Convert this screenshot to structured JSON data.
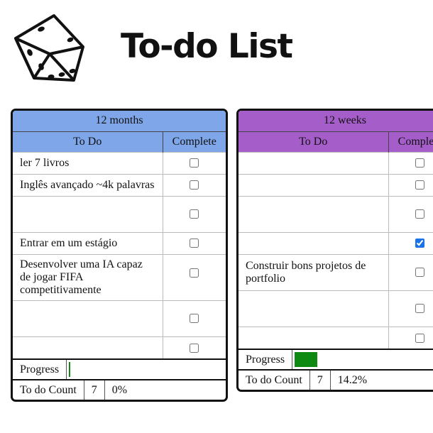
{
  "header": {
    "title": "To-do List",
    "logo_icon": "dice-icon"
  },
  "panels": [
    {
      "title": "12 months",
      "accent": "#7ea6e8",
      "columns": {
        "todo": "To Do",
        "complete": "Complete"
      },
      "rows": [
        {
          "text": "ler 7 livros",
          "checked": false
        },
        {
          "text": "Inglês avançado ~4k palavras",
          "checked": false
        },
        {
          "text": "",
          "checked": false
        },
        {
          "text": "Entrar em um estágio",
          "checked": false
        },
        {
          "text": "Desenvolver uma IA capaz de jogar FIFA competitivamente",
          "checked": false
        },
        {
          "text": "",
          "checked": false
        },
        {
          "text": "",
          "checked": false
        }
      ],
      "progress": {
        "label": "Progress",
        "fraction": 0.0
      },
      "count": {
        "label": "To do Count",
        "value": "7",
        "percent": "0%"
      }
    },
    {
      "title": "12 weeks",
      "accent": "#a55ec9",
      "columns": {
        "todo": "To Do",
        "complete": "Complete"
      },
      "rows": [
        {
          "text": "",
          "checked": false
        },
        {
          "text": "",
          "checked": false
        },
        {
          "text": "",
          "checked": false
        },
        {
          "text": "",
          "checked": true
        },
        {
          "text": "Construir bons projetos de portfolio",
          "checked": false
        },
        {
          "text": "",
          "checked": false
        },
        {
          "text": "",
          "checked": false
        }
      ],
      "progress": {
        "label": "Progress",
        "fraction": 0.142
      },
      "count": {
        "label": "To do Count",
        "value": "7",
        "percent": "14.2%"
      }
    }
  ]
}
